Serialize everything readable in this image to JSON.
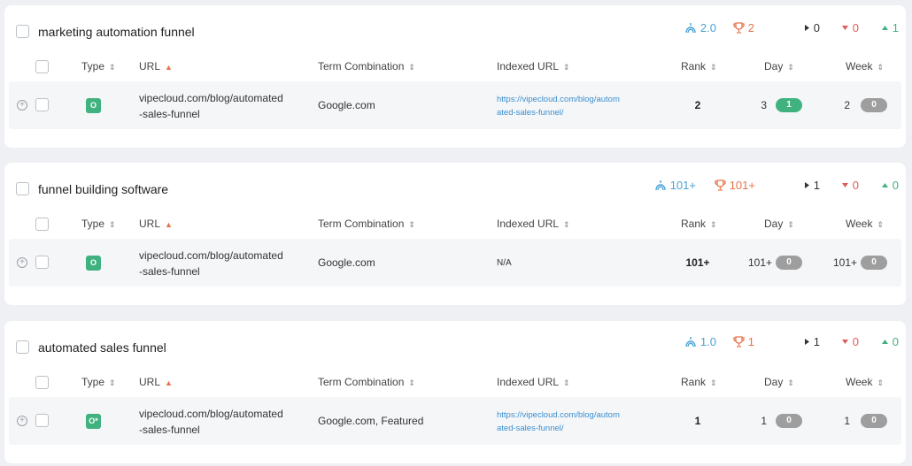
{
  "columns": {
    "type": "Type",
    "url": "URL",
    "term": "Term Combination",
    "indexed": "Indexed URL",
    "rank": "Rank",
    "day": "Day",
    "week": "Week"
  },
  "sort_symbol": "⇕",
  "sort_up_symbol": "▲",
  "cards": [
    {
      "keyword": "marketing automation funnel",
      "stats": {
        "visibility": "2.0",
        "best": "2",
        "same": "0",
        "down": "0",
        "up": "1"
      },
      "row": {
        "type_icon": "O",
        "url_line1": "vipecloud.com/blog/automated",
        "url_line2": "-sales-funnel",
        "term": "Google.com",
        "indexed_line1": "https://vipecloud.com/blog/autom",
        "indexed_line2": "ated-sales-funnel/",
        "rank": "2",
        "day_value": "3",
        "day_change": "1",
        "week_value": "2",
        "week_change": "0"
      }
    },
    {
      "keyword": "funnel building software",
      "stats": {
        "visibility": "101+",
        "best": "101+",
        "same": "1",
        "down": "0",
        "up": "0"
      },
      "row": {
        "type_icon": "O",
        "url_line1": "vipecloud.com/blog/automated",
        "url_line2": "-sales-funnel",
        "term": "Google.com",
        "indexed_line1": "N/A",
        "indexed_line2": "",
        "rank": "101+",
        "day_value": "101+",
        "day_change": "0",
        "week_value": "101+",
        "week_change": "0"
      }
    },
    {
      "keyword": "automated sales funnel",
      "stats": {
        "visibility": "1.0",
        "best": "1",
        "same": "1",
        "down": "0",
        "up": "0"
      },
      "row": {
        "type_icon": "O*",
        "url_line1": "vipecloud.com/blog/automated",
        "url_line2": "-sales-funnel",
        "term": "Google.com, Featured",
        "indexed_line1": "https://vipecloud.com/blog/autom",
        "indexed_line2": "ated-sales-funnel/",
        "rank": "1",
        "day_value": "1",
        "day_change": "0",
        "week_value": "1",
        "week_change": "0"
      }
    }
  ],
  "colors": {
    "accent_blue": "#4aa3d6",
    "accent_orange": "#e8734a",
    "down_red": "#e25a5a",
    "up_green": "#3fb27f",
    "pill_gray": "#9e9e9e"
  }
}
